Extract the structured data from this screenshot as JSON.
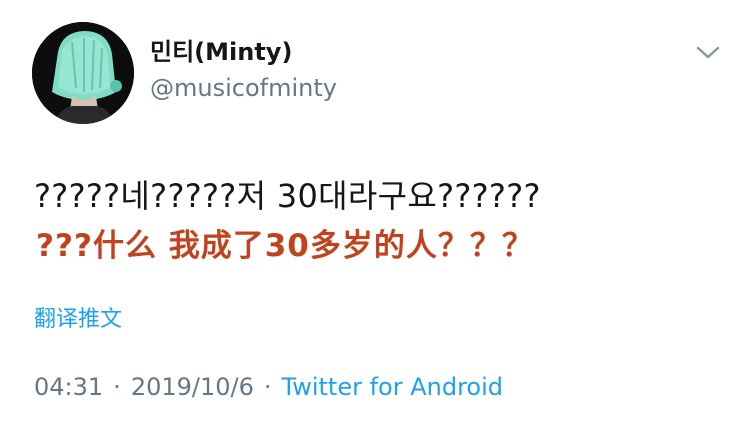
{
  "user": {
    "display_name": "민티(Minty)",
    "handle": "@musicofminty",
    "avatar_icon": "profile-avatar-teal-hair"
  },
  "menu": {
    "icon": "chevron-down-icon"
  },
  "tweet": {
    "text": "?????네?????저 30대라구요??????",
    "annotation": "???什么 我成了30多岁的人？？？",
    "translate_label": "翻译推文"
  },
  "meta": {
    "time": "04:31",
    "separator": "·",
    "date": "2019/10/6",
    "source": "Twitter for Android"
  },
  "colors": {
    "link": "#1da1f2",
    "secondary": "#657786",
    "primary_text": "#14171a",
    "annotation": "#c1431d"
  }
}
